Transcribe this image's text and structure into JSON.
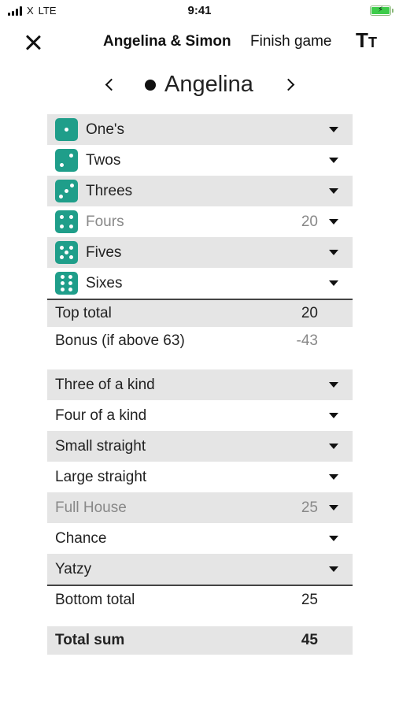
{
  "status_bar": {
    "carrier": "X",
    "network": "LTE",
    "time": "9:41",
    "battery_icon": "battery-charging-icon",
    "battery_color": "#3dcc4a"
  },
  "nav": {
    "close_icon": "close-icon",
    "title": "Angelina & Simon",
    "finish_label": "Finish game",
    "font_size_icon": "text-size-icon"
  },
  "player": {
    "name": "Angelina",
    "prev_icon": "chevron-left-icon",
    "next_icon": "chevron-right-icon"
  },
  "colors": {
    "die": "#1f9e8a",
    "row_shade": "#e5e5e5"
  },
  "upper_section": [
    {
      "label": "One's",
      "value": "",
      "die": 1
    },
    {
      "label": "Twos",
      "value": "",
      "die": 2
    },
    {
      "label": "Threes",
      "value": "",
      "die": 3
    },
    {
      "label": "Fours",
      "value": "20",
      "die": 4
    },
    {
      "label": "Fives",
      "value": "",
      "die": 5
    },
    {
      "label": "Sixes",
      "value": "",
      "die": 6
    }
  ],
  "top_total": {
    "label": "Top total",
    "value": "20"
  },
  "bonus": {
    "label": "Bonus (if above 63)",
    "value": "-43"
  },
  "lower_section": [
    {
      "label": "Three of a kind",
      "value": ""
    },
    {
      "label": "Four of a kind",
      "value": ""
    },
    {
      "label": "Small straight",
      "value": ""
    },
    {
      "label": "Large straight",
      "value": ""
    },
    {
      "label": "Full House",
      "value": "25"
    },
    {
      "label": "Chance",
      "value": ""
    },
    {
      "label": "Yatzy",
      "value": ""
    }
  ],
  "bottom_total": {
    "label": "Bottom total",
    "value": "25"
  },
  "total_sum": {
    "label": "Total sum",
    "value": "45"
  }
}
